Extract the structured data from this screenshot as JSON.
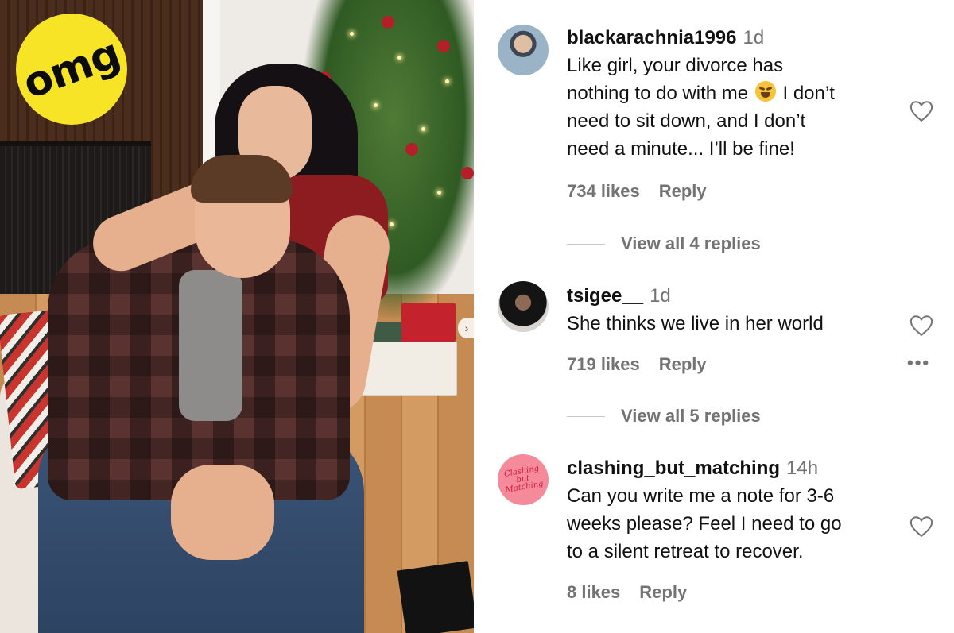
{
  "badge": {
    "text": "omg",
    "color": "#f7e427"
  },
  "photo": {
    "next_icon": "chevron-right-icon"
  },
  "comments": [
    {
      "username": "blackarachnia1996",
      "age": "1d",
      "lines": [
        "Like girl, your divorce has",
        "nothing to do with me",
        "I don’t",
        "need to sit down, and I don’t",
        "need a minute... I’ll be fine!"
      ],
      "emoji": "face-with-tears-of-joy-icon",
      "likes": "734 likes",
      "reply": "Reply",
      "view_replies": "View all 4 replies"
    },
    {
      "username": "tsigee__",
      "age": "1d",
      "lines": [
        "She thinks we live in her world"
      ],
      "likes": "719 likes",
      "reply": "Reply",
      "more": "•••",
      "view_replies": "View all 5 replies"
    },
    {
      "username": "clashing_but_matching",
      "age": "14h",
      "avatar_text": "Clashing but Matching",
      "lines": [
        "Can you write me a note for 3-6",
        "weeks please? Feel I need to go",
        "to a silent retreat to recover."
      ],
      "likes": "8 likes",
      "reply": "Reply"
    }
  ],
  "colors": {
    "secondary_text": "#737373",
    "username": "#111111",
    "avatar_pink": "#f48a9a"
  }
}
